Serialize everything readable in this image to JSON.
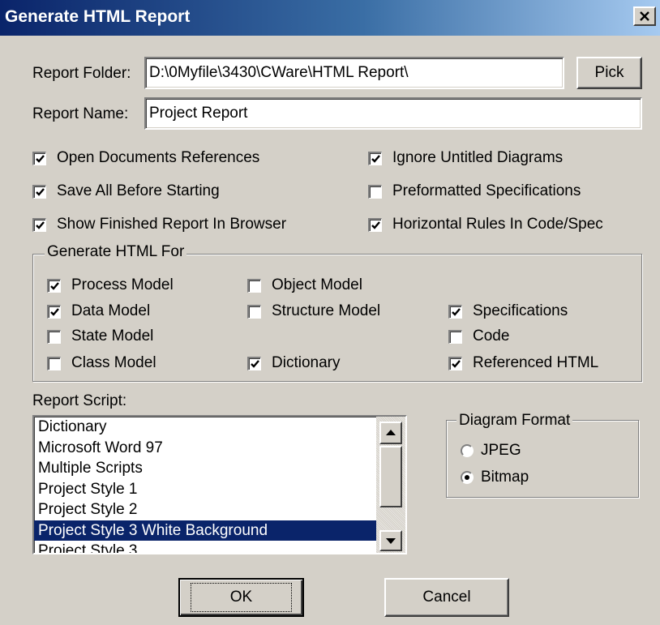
{
  "window": {
    "title": "Generate HTML Report"
  },
  "report_folder": {
    "label": "Report Folder:",
    "value": "D:\\0Myfile\\3430\\CWare\\HTML Report\\",
    "pick_label": "Pick"
  },
  "report_name": {
    "label": "Report Name:",
    "value": "Project Report"
  },
  "options": [
    {
      "label": "Open Documents References",
      "checked": true
    },
    {
      "label": "Ignore Untitled Diagrams",
      "checked": true
    },
    {
      "label": "Save All Before Starting",
      "checked": true
    },
    {
      "label": "Preformatted Specifications",
      "checked": false
    },
    {
      "label": "Show Finished Report In Browser",
      "checked": true
    },
    {
      "label": "Horizontal Rules In Code/Spec",
      "checked": true
    }
  ],
  "generate_for": {
    "title": "Generate HTML For",
    "items": [
      {
        "label": "Process Model",
        "checked": true
      },
      {
        "label": "Object Model",
        "checked": false
      },
      {
        "label": "Data Model",
        "checked": true
      },
      {
        "label": "Structure Model",
        "checked": false
      },
      {
        "label": "Specifications",
        "checked": true
      },
      {
        "label": "State Model",
        "checked": false
      },
      {
        "label": "Code",
        "checked": false
      },
      {
        "label": "Class Model",
        "checked": false
      },
      {
        "label": "Dictionary",
        "checked": true
      },
      {
        "label": "Referenced HTML",
        "checked": true
      }
    ]
  },
  "report_script": {
    "label": "Report Script:",
    "items": [
      "Dictionary",
      "Microsoft Word 97",
      "Multiple Scripts",
      "Project Style 1",
      "Project Style 2",
      "Project Style 3 White Background",
      "Project Style 3"
    ],
    "selected": "Project Style 3 White Background"
  },
  "diagram_format": {
    "title": "Diagram Format",
    "options": [
      {
        "label": "JPEG",
        "selected": false
      },
      {
        "label": "Bitmap",
        "selected": true
      }
    ]
  },
  "buttons": {
    "ok": "OK",
    "cancel": "Cancel"
  },
  "colors": {
    "titlebar_start": "#0a246a",
    "titlebar_end": "#a6caf0",
    "face": "#d4d0c8",
    "selection": "#0a246a"
  }
}
